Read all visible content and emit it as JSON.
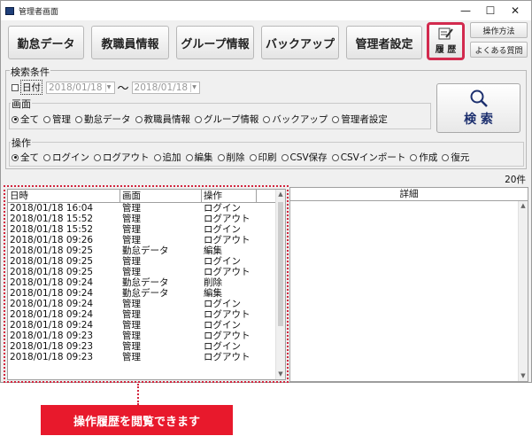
{
  "window": {
    "title": "管理者画面",
    "controls": [
      "—",
      "☐",
      "✕"
    ]
  },
  "toolbar": {
    "buttons": [
      "勤怠データ",
      "教職員情報",
      "グループ情報",
      "バックアップ",
      "管理者設定"
    ],
    "history_label": "履 歴",
    "help_label": "操作方法",
    "faq_label": "よくある質問"
  },
  "criteria": {
    "title": "検索条件",
    "date_label": "日付",
    "date_from": "2018/01/18",
    "date_to": "2018/01/18",
    "tilde": "～",
    "screen_title": "画面",
    "screen_options": [
      "全て",
      "管理",
      "勤怠データ",
      "教職員情報",
      "グループ情報",
      "バックアップ",
      "管理者設定"
    ],
    "op_title": "操作",
    "op_options": [
      "全て",
      "ログイン",
      "ログアウト",
      "追加",
      "編集",
      "削除",
      "印刷",
      "CSV保存",
      "CSVインポート",
      "作成",
      "復元"
    ],
    "search_label": "検 索"
  },
  "count": "20件",
  "list": {
    "headers": [
      "日時",
      "画面",
      "操作",
      ""
    ],
    "rows": [
      [
        "2018/01/18 16:04",
        "管理",
        "ログイン"
      ],
      [
        "2018/01/18 15:52",
        "管理",
        "ログアウト"
      ],
      [
        "2018/01/18 15:52",
        "管理",
        "ログイン"
      ],
      [
        "2018/01/18 09:26",
        "管理",
        "ログアウト"
      ],
      [
        "2018/01/18 09:25",
        "勤怠データ",
        "編集"
      ],
      [
        "2018/01/18 09:25",
        "管理",
        "ログイン"
      ],
      [
        "2018/01/18 09:25",
        "管理",
        "ログアウト"
      ],
      [
        "2018/01/18 09:24",
        "勤怠データ",
        "削除"
      ],
      [
        "2018/01/18 09:24",
        "勤怠データ",
        "編集"
      ],
      [
        "2018/01/18 09:24",
        "管理",
        "ログイン"
      ],
      [
        "2018/01/18 09:24",
        "管理",
        "ログアウト"
      ],
      [
        "2018/01/18 09:24",
        "管理",
        "ログイン"
      ],
      [
        "2018/01/18 09:23",
        "管理",
        "ログアウト"
      ],
      [
        "2018/01/18 09:23",
        "管理",
        "ログイン"
      ],
      [
        "2018/01/18 09:23",
        "管理",
        "ログアウト"
      ]
    ]
  },
  "detail": {
    "header": "詳細"
  },
  "callout": "操作履歴を閲覧できます",
  "colors": {
    "accent": "#e8192c",
    "highlight_border": "#d22a4e"
  }
}
